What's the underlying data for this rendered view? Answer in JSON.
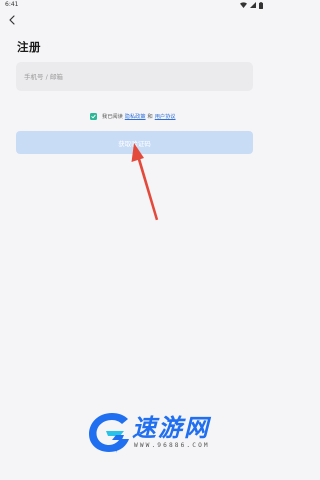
{
  "status_bar": {
    "time": "6:41",
    "icons": [
      "wifi-icon",
      "signal-icon",
      "battery-icon"
    ]
  },
  "header": {
    "back_icon": "chevron-left-icon",
    "title": "注册"
  },
  "form": {
    "account": {
      "value": "",
      "placeholder": "手机号 / 邮箱"
    },
    "agreement": {
      "checked": true,
      "prefix": "我已阅读",
      "privacy_link": "隐私政策",
      "and": "和",
      "user_agreement_link": "用户协议"
    },
    "submit_label": "获取验证码"
  },
  "annotation": {
    "arrow_color": "#e44a3c"
  },
  "watermark": {
    "title": "速游网",
    "domain": "WWW.96886.COM"
  },
  "colors": {
    "background": "#f5f5f7",
    "checkbox": "#2cb897",
    "link": "#2f6fd8",
    "button_disabled": "#c9dcf6",
    "watermark_blue": "#1f6ff0",
    "watermark_cyan": "#29c3e8"
  }
}
